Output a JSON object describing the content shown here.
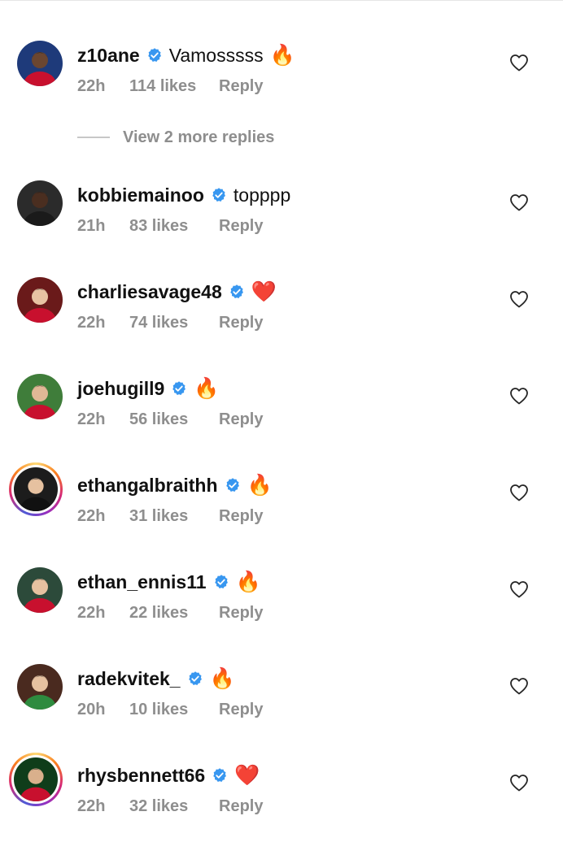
{
  "comments": [
    {
      "username": "z10ane",
      "text": "Vamosssss",
      "emoji": "🔥",
      "time": "22h",
      "likes": "114 likes",
      "reply": "Reply",
      "avatar": {
        "bg": "#1e3a7a",
        "shirt": "#c8102e",
        "skin": "#6b4630",
        "story": false
      }
    },
    {
      "username": "kobbiemainoo",
      "text": "topppp",
      "emoji": "",
      "time": "21h",
      "likes": "83 likes",
      "reply": "Reply",
      "avatar": {
        "bg": "#2b2b2b",
        "shirt": "#1a1a1a",
        "skin": "#4a2e20",
        "story": false
      }
    },
    {
      "username": "charliesavage48",
      "text": "",
      "emoji": "❤️",
      "time": "22h",
      "likes": "74 likes",
      "reply": "Reply",
      "avatar": {
        "bg": "#6a1a1a",
        "shirt": "#c8102e",
        "skin": "#e8c3a3",
        "story": false
      }
    },
    {
      "username": "joehugill9",
      "text": "",
      "emoji": "🔥",
      "time": "22h",
      "likes": "56 likes",
      "reply": "Reply",
      "avatar": {
        "bg": "#3f7d3a",
        "shirt": "#c8102e",
        "skin": "#e0b896",
        "story": false
      }
    },
    {
      "username": "ethangalbraithh",
      "text": "",
      "emoji": "🔥",
      "time": "22h",
      "likes": "31 likes",
      "reply": "Reply",
      "avatar": {
        "bg": "#1c1c1c",
        "shirt": "#111111",
        "skin": "#e6c1a0",
        "story": true
      }
    },
    {
      "username": "ethan_ennis11",
      "text": "",
      "emoji": "🔥",
      "time": "22h",
      "likes": "22 likes",
      "reply": "Reply",
      "avatar": {
        "bg": "#2c4a3a",
        "shirt": "#c8102e",
        "skin": "#e6c1a0",
        "story": false
      }
    },
    {
      "username": "radekvitek_",
      "text": "",
      "emoji": "🔥",
      "time": "20h",
      "likes": "10 likes",
      "reply": "Reply",
      "avatar": {
        "bg": "#4a2a1f",
        "shirt": "#2e8b3f",
        "skin": "#e6c1a0",
        "story": false
      }
    },
    {
      "username": "rhysbennett66",
      "text": "",
      "emoji": "❤️",
      "time": "22h",
      "likes": "32 likes",
      "reply": "Reply",
      "avatar": {
        "bg": "#0f3d1a",
        "shirt": "#c8102e",
        "skin": "#d9b08c",
        "story": true
      }
    }
  ],
  "more_replies": {
    "label": "View 2 more replies"
  },
  "icons": {
    "verified": "verified-badge-icon",
    "heart": "heart-outline-icon"
  },
  "colors": {
    "verified_blue": "#3897f0",
    "secondary_text": "#8e8e8e"
  }
}
